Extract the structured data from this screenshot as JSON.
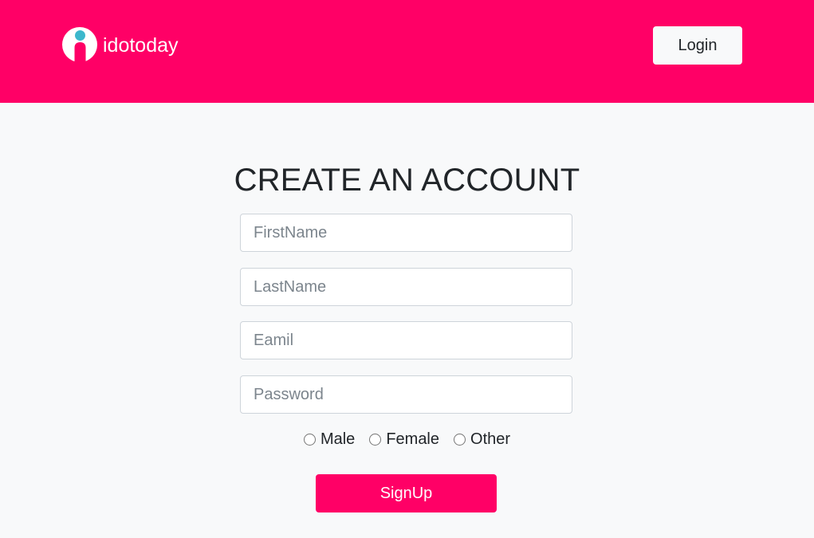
{
  "header": {
    "brand_name": "idotoday",
    "logo_icon": "idotoday-logo-icon",
    "login_label": "Login",
    "background_color": "#ff0066"
  },
  "form": {
    "title": "CREATE AN ACCOUNT",
    "first_name": {
      "placeholder": "FirstName",
      "value": ""
    },
    "last_name": {
      "placeholder": "LastName",
      "value": ""
    },
    "email": {
      "placeholder": "Eamil",
      "value": ""
    },
    "password": {
      "placeholder": "Password",
      "value": ""
    },
    "gender_options": {
      "male": "Male",
      "female": "Female",
      "other": "Other"
    },
    "signup_label": "SignUp",
    "accent_color": "#ff0066"
  }
}
